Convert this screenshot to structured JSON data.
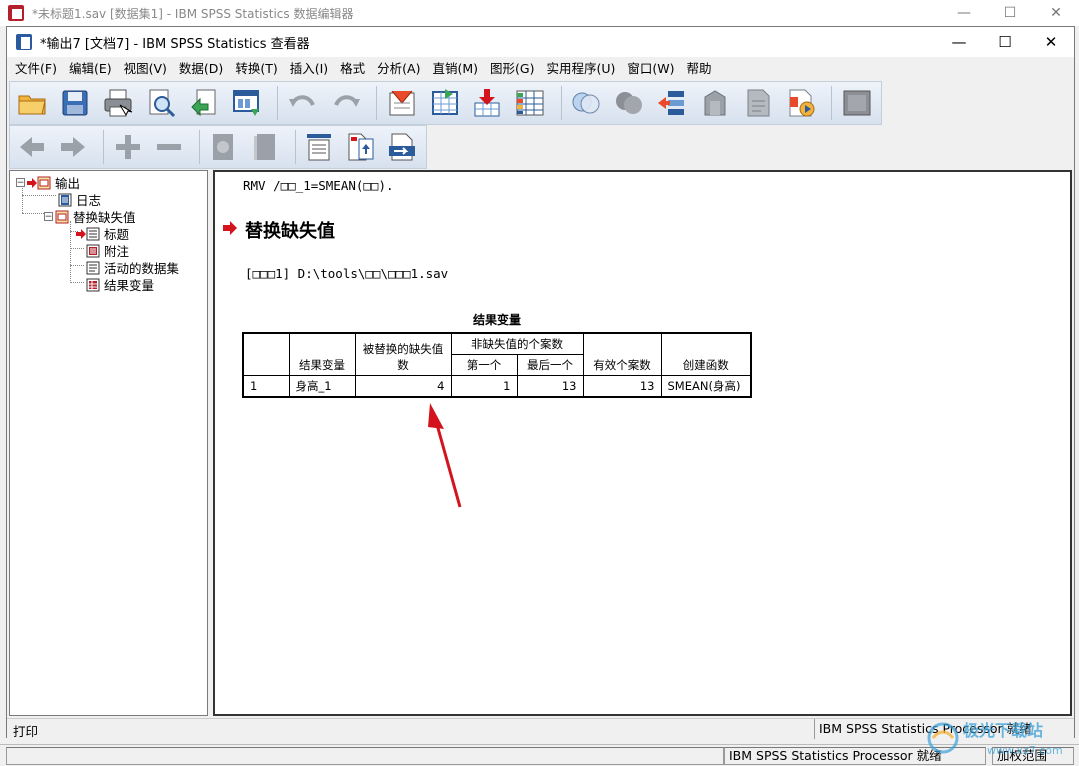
{
  "back_window": {
    "title": "*未标题1.sav [数据集1] - IBM SPSS Statistics 数据编辑器",
    "minimize": "—",
    "maximize": "☐",
    "close": "✕"
  },
  "viewer_window": {
    "title": "*输出7 [文档7] - IBM SPSS Statistics 查看器",
    "minimize": "—",
    "maximize": "☐",
    "close": "✕"
  },
  "menubar": {
    "items": [
      "文件(F)",
      "编辑(E)",
      "视图(V)",
      "数据(D)",
      "转换(T)",
      "插入(I)",
      "格式",
      "分析(A)",
      "直销(M)",
      "图形(G)",
      "实用程序(U)",
      "窗口(W)",
      "帮助"
    ]
  },
  "toolbar1": {
    "icons": [
      "open-icon",
      "save-icon",
      "print-icon",
      "print-preview-icon",
      "export-icon",
      "recall-dialog-icon",
      "undo-icon",
      "redo-icon",
      "goto-data-icon",
      "goto-case-icon",
      "goto-variable-icon",
      "variables-icon",
      "select-cases-icon",
      "weight-cases-icon",
      "split-file-icon",
      "designate-window-icon",
      "pivot-icon",
      "chart-editor-icon",
      "script-icon",
      "fullscreen-icon"
    ]
  },
  "toolbar2": {
    "icons": [
      "back-icon",
      "forward-icon",
      "expand-icon",
      "collapse-icon",
      "show-icon",
      "hide-icon",
      "insert-heading-icon",
      "insert-title-icon",
      "insert-text-icon"
    ]
  },
  "tree": {
    "root": "输出",
    "log": "日志",
    "proc": "替换缺失值",
    "title": "标题",
    "notes": "附注",
    "active_dataset": "活动的数据集",
    "result_variables": "结果变量"
  },
  "content": {
    "syntax": "RMV /□□_1=SMEAN(□□).",
    "heading": "替换缺失值",
    "dataset_line": "[□□□1] D:\\tools\\□□\\□□□1.sav",
    "table_title": "结果变量",
    "table": {
      "headers": {
        "col1": "",
        "col2": "结果变量",
        "col3": "被替换的缺失值数",
        "nonmissing_group": "非缺失值的个案数",
        "first": "第一个",
        "last": "最后一个",
        "valid": "有效个案数",
        "func": "创建函数"
      },
      "rows": [
        {
          "idx": "1",
          "var": "身高_1",
          "replaced": "4",
          "first": "1",
          "last": "13",
          "valid": "13",
          "func": "SMEAN(身高)"
        }
      ]
    }
  },
  "status_inner": {
    "left": "打印",
    "right": "IBM SPSS Statistics Processor 就绪"
  },
  "status_outer": {
    "processor": "IBM SPSS Statistics Processor 就绪",
    "weight": "加权范围"
  },
  "watermark": {
    "text": "极光下载站",
    "url": "www.xz7.com"
  },
  "colors": {
    "accent_red": "#d4141c",
    "toolbar_gradient_top": "#eef3fa",
    "toolbar_gradient_bottom": "#d7e1ee"
  }
}
